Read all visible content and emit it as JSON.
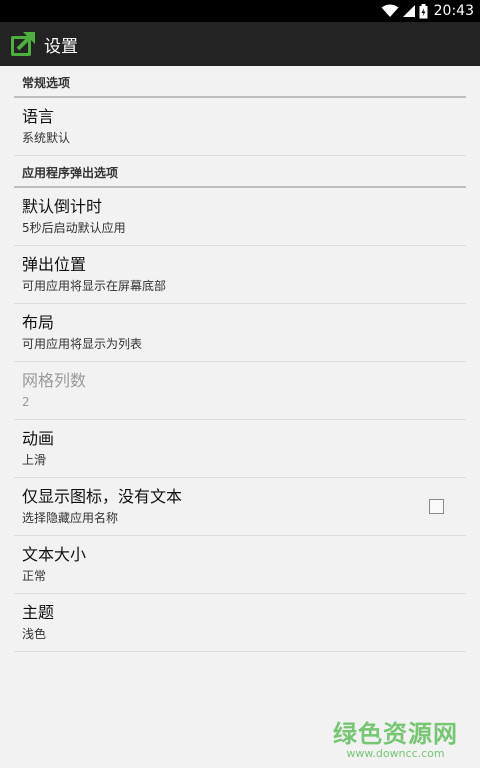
{
  "status_bar": {
    "time": "20:43",
    "icons": [
      "wifi-icon",
      "signal-icon",
      "battery-icon"
    ]
  },
  "action_bar": {
    "title": "设置",
    "icon": "open-external-icon"
  },
  "sections": [
    {
      "header": "常规选项",
      "items": [
        {
          "title": "语言",
          "summary": "系统默认"
        }
      ]
    },
    {
      "header": "应用程序弹出选项",
      "items": [
        {
          "title": "默认倒计时",
          "summary": "5秒后启动默认应用"
        },
        {
          "title": "弹出位置",
          "summary": "可用应用将显示在屏幕底部"
        },
        {
          "title": "布局",
          "summary": "可用应用将显示为列表"
        },
        {
          "title": "网格列数",
          "summary": "2",
          "disabled": true
        },
        {
          "title": "动画",
          "summary": "上滑"
        },
        {
          "title": "仅显示图标，没有文本",
          "summary": "选择隐藏应用名称",
          "checkbox": false
        },
        {
          "title": "文本大小",
          "summary": "正常"
        },
        {
          "title": "主题",
          "summary": "浅色"
        }
      ]
    }
  ],
  "watermark": {
    "name": "绿色资源网",
    "url": "www.downcc.com"
  },
  "colors": {
    "action_bar": "#232323",
    "background": "#f2f2f2",
    "icon_green": "#4caf3e"
  }
}
